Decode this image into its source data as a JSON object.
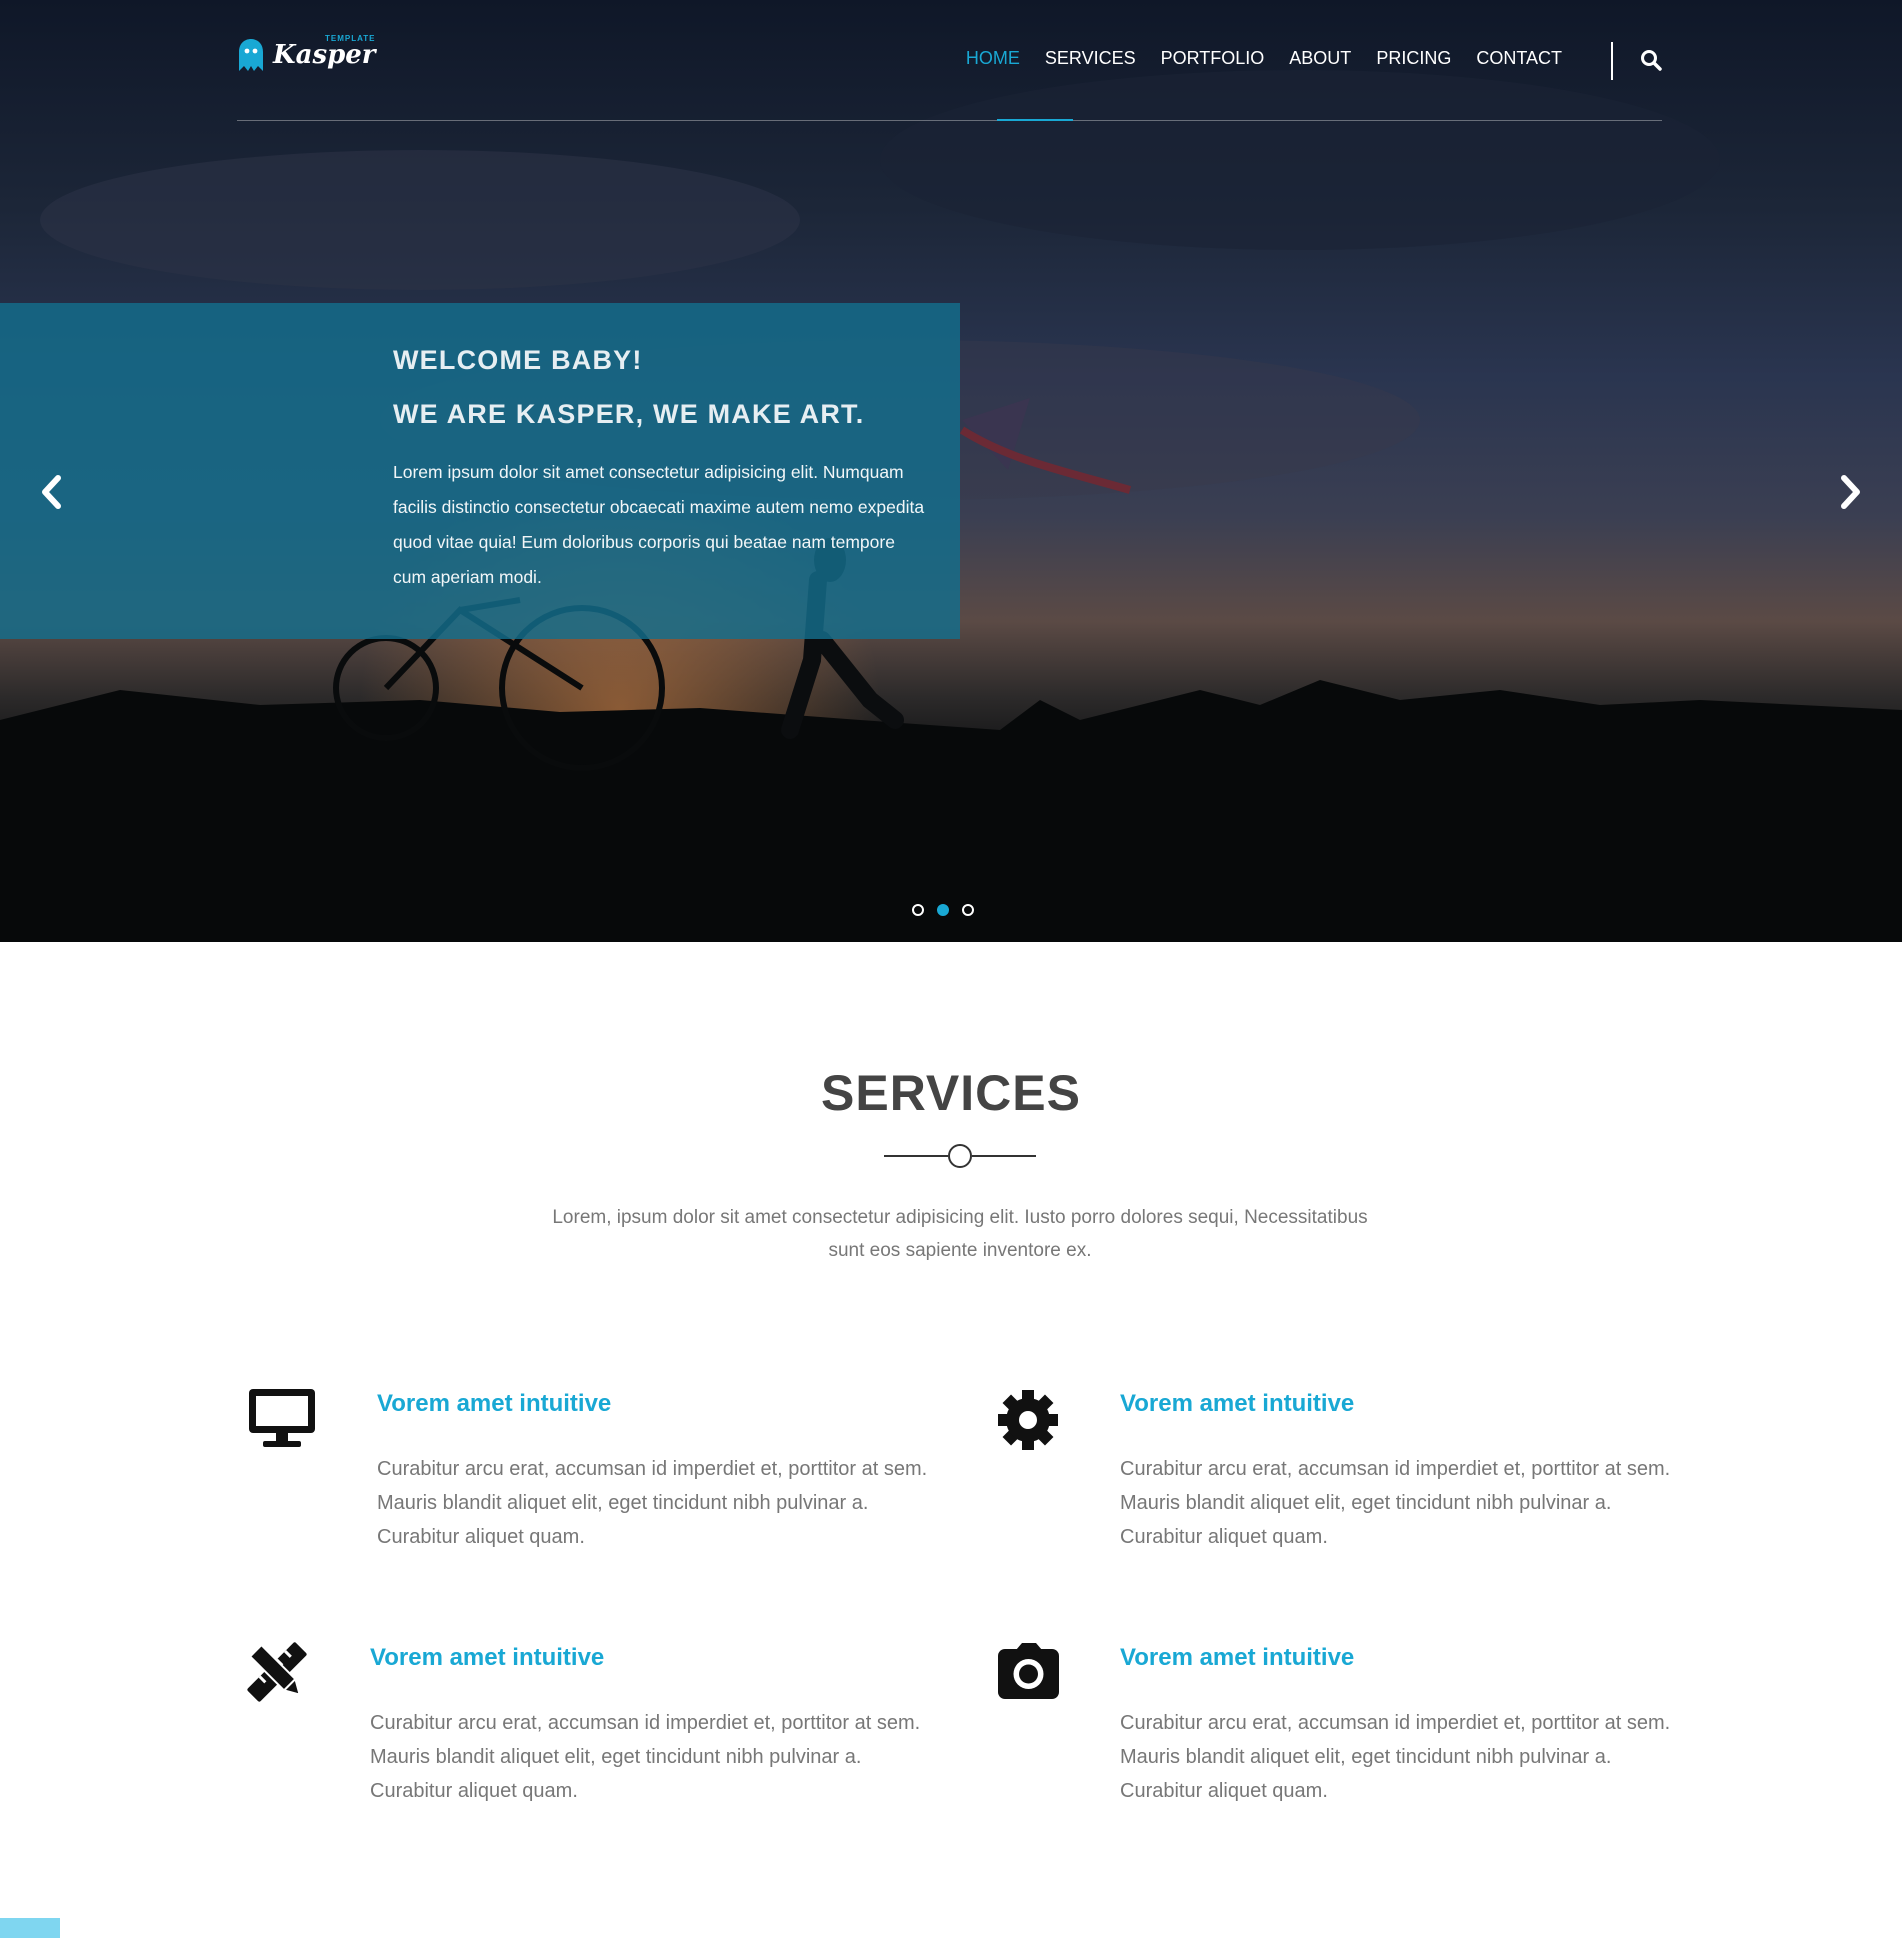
{
  "brand": {
    "name": "Kasper",
    "tag": "TEMPLATE"
  },
  "nav": {
    "items": [
      "HOME",
      "SERVICES",
      "PORTFOLIO",
      "ABOUT",
      "PRICING",
      "CONTACT"
    ],
    "active": "HOME"
  },
  "slider": {
    "heading1": "WELCOME BABY!",
    "heading2": "WE ARE KASPER, WE MAKE ART.",
    "text": "Lorem ipsum dolor sit amet consectetur adipisicing elit. Numquam facilis distinctio consectetur obcaecati maxime autem nemo expedita quod vitae quia! Eum doloribus corporis qui beatae nam tempore cum aperiam modi.",
    "slides": 3,
    "active_slide": 2
  },
  "services": {
    "title": "SERVICES",
    "intro": "Lorem, ipsum dolor sit amet consectetur adipisicing elit. Iusto porro dolores sequi, Necessitatibus sunt eos sapiente inventore ex.",
    "items": [
      {
        "icon": "desktop-icon",
        "title": "Vorem amet intuitive",
        "text": "Curabitur arcu erat, accumsan id imperdiet et, porttitor at sem. Mauris blandit aliquet elit, eget tincidunt nibh pulvinar a. Curabitur aliquet quam."
      },
      {
        "icon": "gear-icon",
        "title": "Vorem amet intuitive",
        "text": "Curabitur arcu erat, accumsan id imperdiet et, porttitor at sem. Mauris blandit aliquet elit, eget tincidunt nibh pulvinar a. Curabitur aliquet quam."
      },
      {
        "icon": "pencil-ruler-icon",
        "title": "Vorem amet intuitive",
        "text": "Curabitur arcu erat, accumsan id imperdiet et, porttitor at sem. Mauris blandit aliquet elit, eget tincidunt nibh pulvinar a. Curabitur aliquet quam."
      },
      {
        "icon": "camera-icon",
        "title": "Vorem amet intuitive",
        "text": "Curabitur arcu erat, accumsan id imperdiet et, porttitor at sem. Mauris blandit aliquet elit, eget tincidunt nibh pulvinar a. Curabitur aliquet quam."
      }
    ]
  },
  "colors": {
    "accent": "#19a8d4",
    "overlay": "#146e8c",
    "text_muted": "#777777"
  }
}
